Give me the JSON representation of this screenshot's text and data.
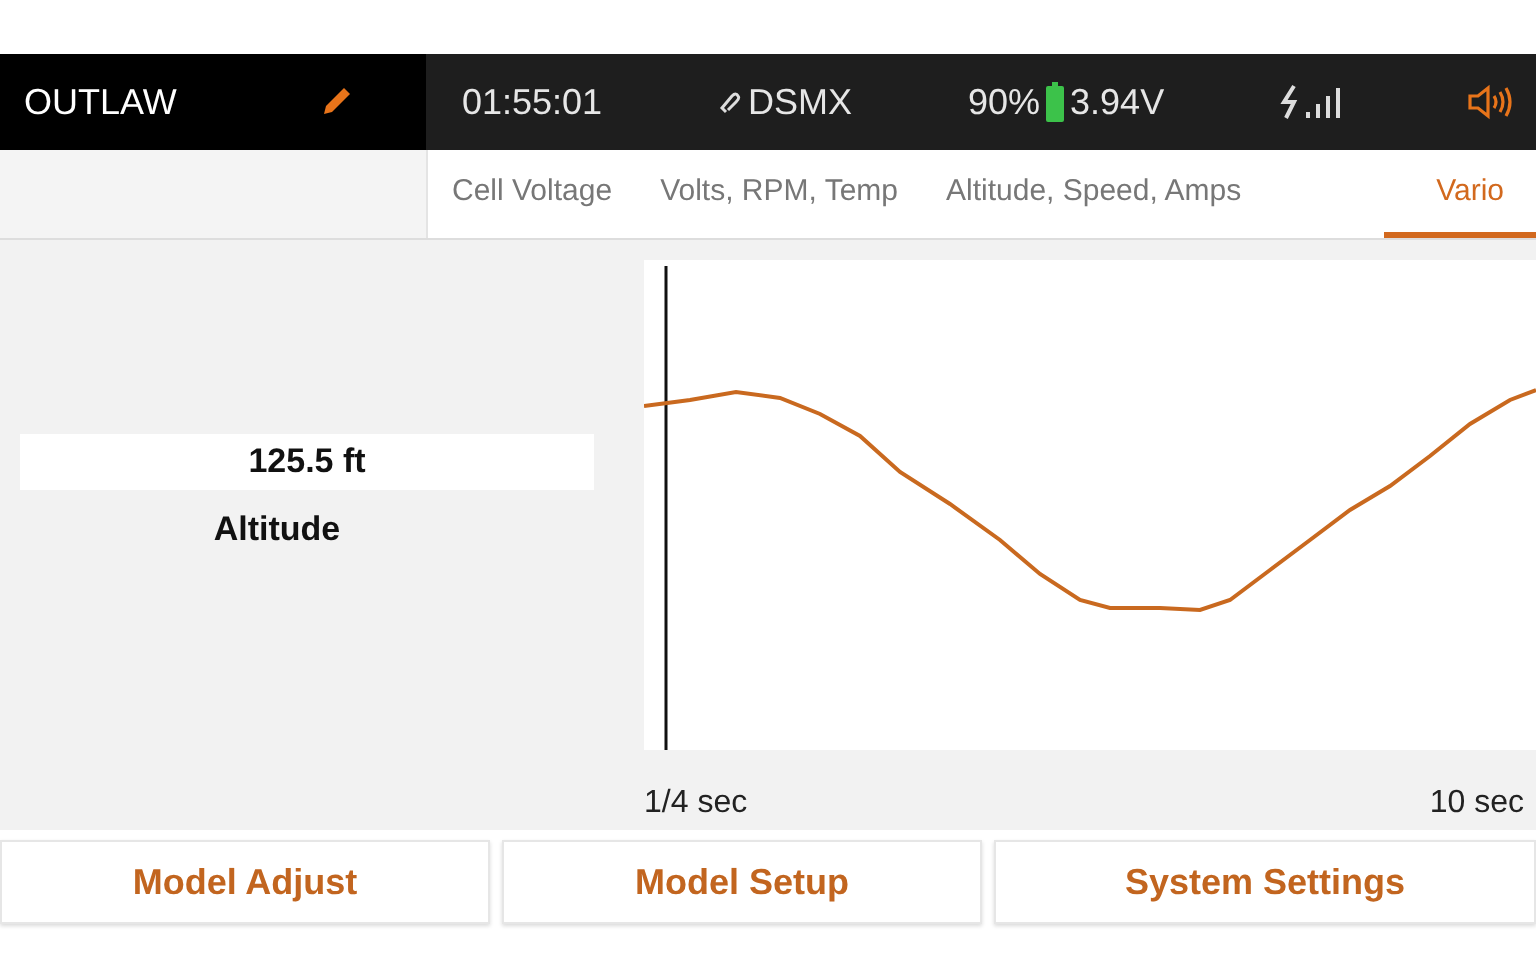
{
  "header": {
    "model_name": "OUTLAW",
    "timer": "01:55:01",
    "protocol": "DSMX",
    "battery_percent": "90%",
    "voltage": "3.94V"
  },
  "tabs": [
    {
      "label": "Cell Voltage",
      "selected": false
    },
    {
      "label": "Volts, RPM, Temp",
      "selected": false
    },
    {
      "label": "Altitude, Speed, Amps",
      "selected": false
    },
    {
      "label": "Vario",
      "selected": true
    }
  ],
  "readout": {
    "value": "125.5 ft",
    "label": "Altitude"
  },
  "graph": {
    "x_start": "1/4 sec",
    "x_end": "10 sec"
  },
  "buttons": [
    "Model Adjust",
    "Model Setup",
    "System Settings"
  ]
}
